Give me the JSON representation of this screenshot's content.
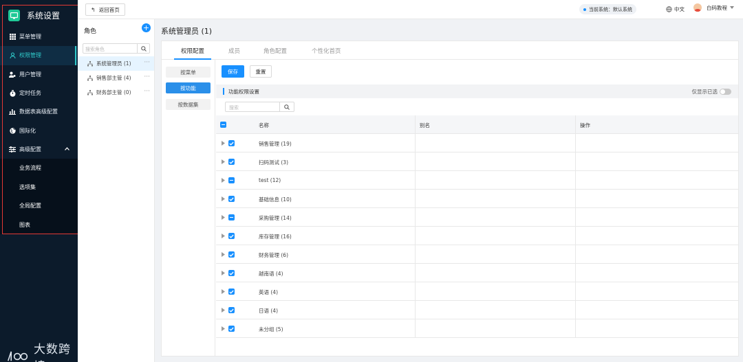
{
  "app": {
    "title": "系统设置",
    "watermark": "大数跨境",
    "colors": {
      "accent": "#1890ff",
      "sidebar_bg": "#0c1b2b",
      "sidebar_active": "#2fc9c9",
      "annotation": "#e53935"
    }
  },
  "sidebar": {
    "items": [
      {
        "label": "菜单管理",
        "icon": "grid-icon"
      },
      {
        "label": "权限管理",
        "icon": "user-icon",
        "active": true
      },
      {
        "label": "用户管理",
        "icon": "user-gear-icon"
      },
      {
        "label": "定时任务",
        "icon": "timer-icon"
      },
      {
        "label": "数据表高级配置",
        "icon": "bar-chart-icon"
      },
      {
        "label": "国际化",
        "icon": "globe-icon"
      },
      {
        "label": "高级配置",
        "icon": "sliders-icon",
        "expanded": true
      }
    ],
    "subitems": [
      "业务流程",
      "选项集",
      "全局配置",
      "图表"
    ]
  },
  "topbar": {
    "back_label": "返回首页",
    "current_system": "当前系统：默认系统",
    "language": "中文",
    "user": "白码教程"
  },
  "roles_panel": {
    "title": "角色",
    "search_placeholder": "搜索角色",
    "roles": [
      "系统管理员 (1)",
      "销售部主管 (4)",
      "财务部主管 (0)"
    ],
    "more_glyph": "···"
  },
  "main": {
    "title": "系统管理员 (1)",
    "tabs": [
      "权限配置",
      "成员",
      "角色配置",
      "个性化首页"
    ],
    "left_nav": [
      "按菜单",
      "按功能",
      "按数据集"
    ],
    "save_label": "保存",
    "reset_label": "重置",
    "section_label": "功能权限设置",
    "only_selected_label": "仅显示已选",
    "search_placeholder": "搜索",
    "columns": [
      "名称",
      "别名",
      "操作"
    ],
    "rows": [
      {
        "name": "销售管理 (19)",
        "state": "checked"
      },
      {
        "name": "扫码测试 (3)",
        "state": "checked"
      },
      {
        "name": "test (12)",
        "state": "partial"
      },
      {
        "name": "基础信息 (10)",
        "state": "checked"
      },
      {
        "name": "采购管理 (14)",
        "state": "partial"
      },
      {
        "name": "库存管理 (16)",
        "state": "checked"
      },
      {
        "name": "财务管理 (6)",
        "state": "checked"
      },
      {
        "name": "越南语 (4)",
        "state": "checked"
      },
      {
        "name": "英语 (4)",
        "state": "checked"
      },
      {
        "name": "日语 (4)",
        "state": "checked"
      },
      {
        "name": "未分组 (5)",
        "state": "checked"
      }
    ]
  }
}
